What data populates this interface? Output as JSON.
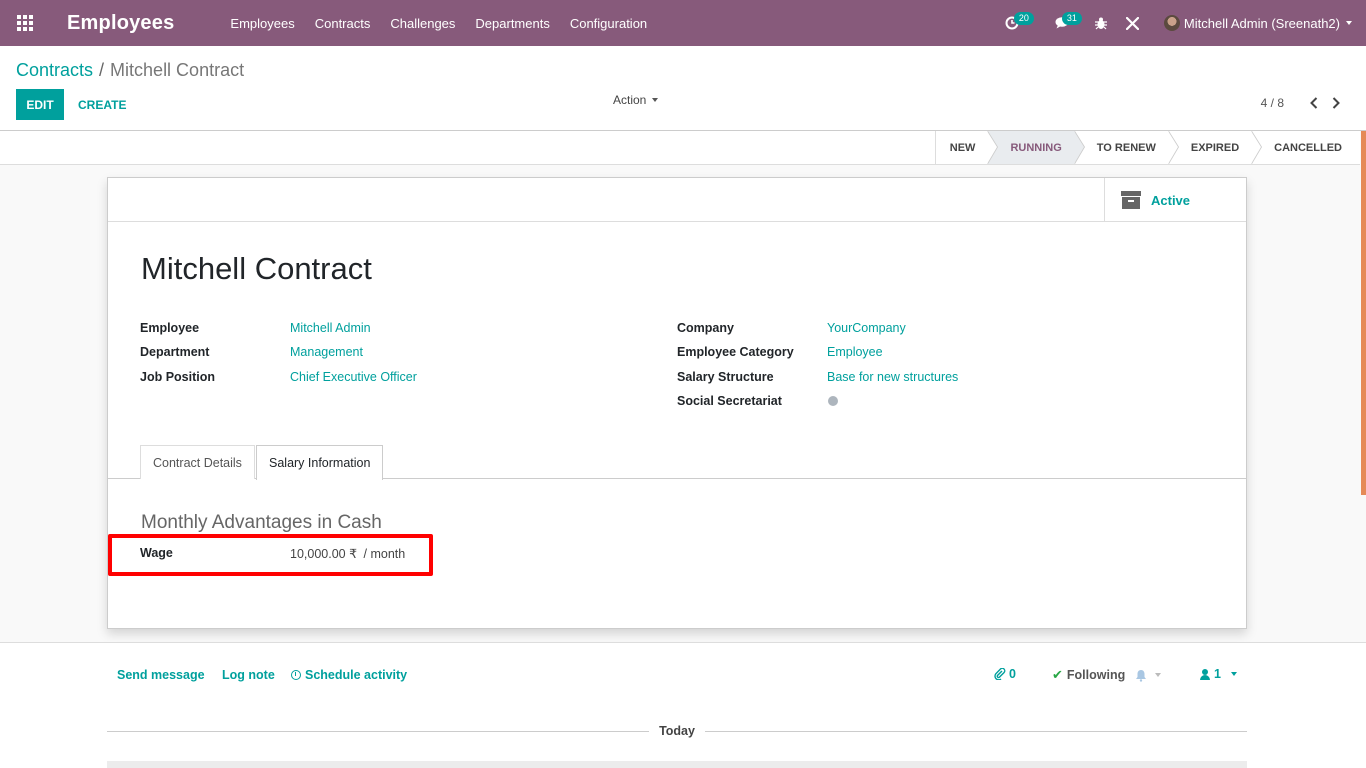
{
  "navbar": {
    "app_title": "Employees",
    "menu": [
      "Employees",
      "Contracts",
      "Challenges",
      "Departments",
      "Configuration"
    ],
    "activity_count": "20",
    "messages_count": "31",
    "user_name": "Mitchell Admin (Sreenath2)"
  },
  "breadcrumb": {
    "parent": "Contracts",
    "separator": "/",
    "current": "Mitchell Contract"
  },
  "buttons": {
    "edit": "EDIT",
    "create": "CREATE",
    "action": "Action"
  },
  "pager": {
    "value": "4 / 8"
  },
  "stages": [
    "NEW",
    "RUNNING",
    "TO RENEW",
    "EXPIRED",
    "CANCELLED"
  ],
  "active_stage": "RUNNING",
  "form": {
    "active_label": "Active",
    "title": "Mitchell Contract",
    "left_fields": [
      {
        "label": "Employee",
        "value": "Mitchell Admin"
      },
      {
        "label": "Department",
        "value": "Management"
      },
      {
        "label": "Job Position",
        "value": "Chief Executive Officer"
      }
    ],
    "right_fields": [
      {
        "label": "Company",
        "value": "YourCompany"
      },
      {
        "label": "Employee Category",
        "value": "Employee"
      },
      {
        "label": "Salary Structure",
        "value": "Base for new structures"
      },
      {
        "label": "Social Secretariat",
        "value": ""
      }
    ],
    "tabs": [
      "Contract Details",
      "Salary Information"
    ],
    "active_tab": "Salary Information",
    "section_title": "Monthly Advantages in Cash",
    "wage_label": "Wage",
    "wage_value": "10,000.00 ₹",
    "wage_unit": "/ month"
  },
  "chatter": {
    "send_message": "Send message",
    "log_note": "Log note",
    "schedule_activity": "Schedule activity",
    "attachments": "0",
    "following": "Following",
    "followers": "1",
    "today": "Today"
  },
  "colors": {
    "navbar": "#875a7b",
    "accent": "#00a09d",
    "highlight": "#ff0000"
  }
}
